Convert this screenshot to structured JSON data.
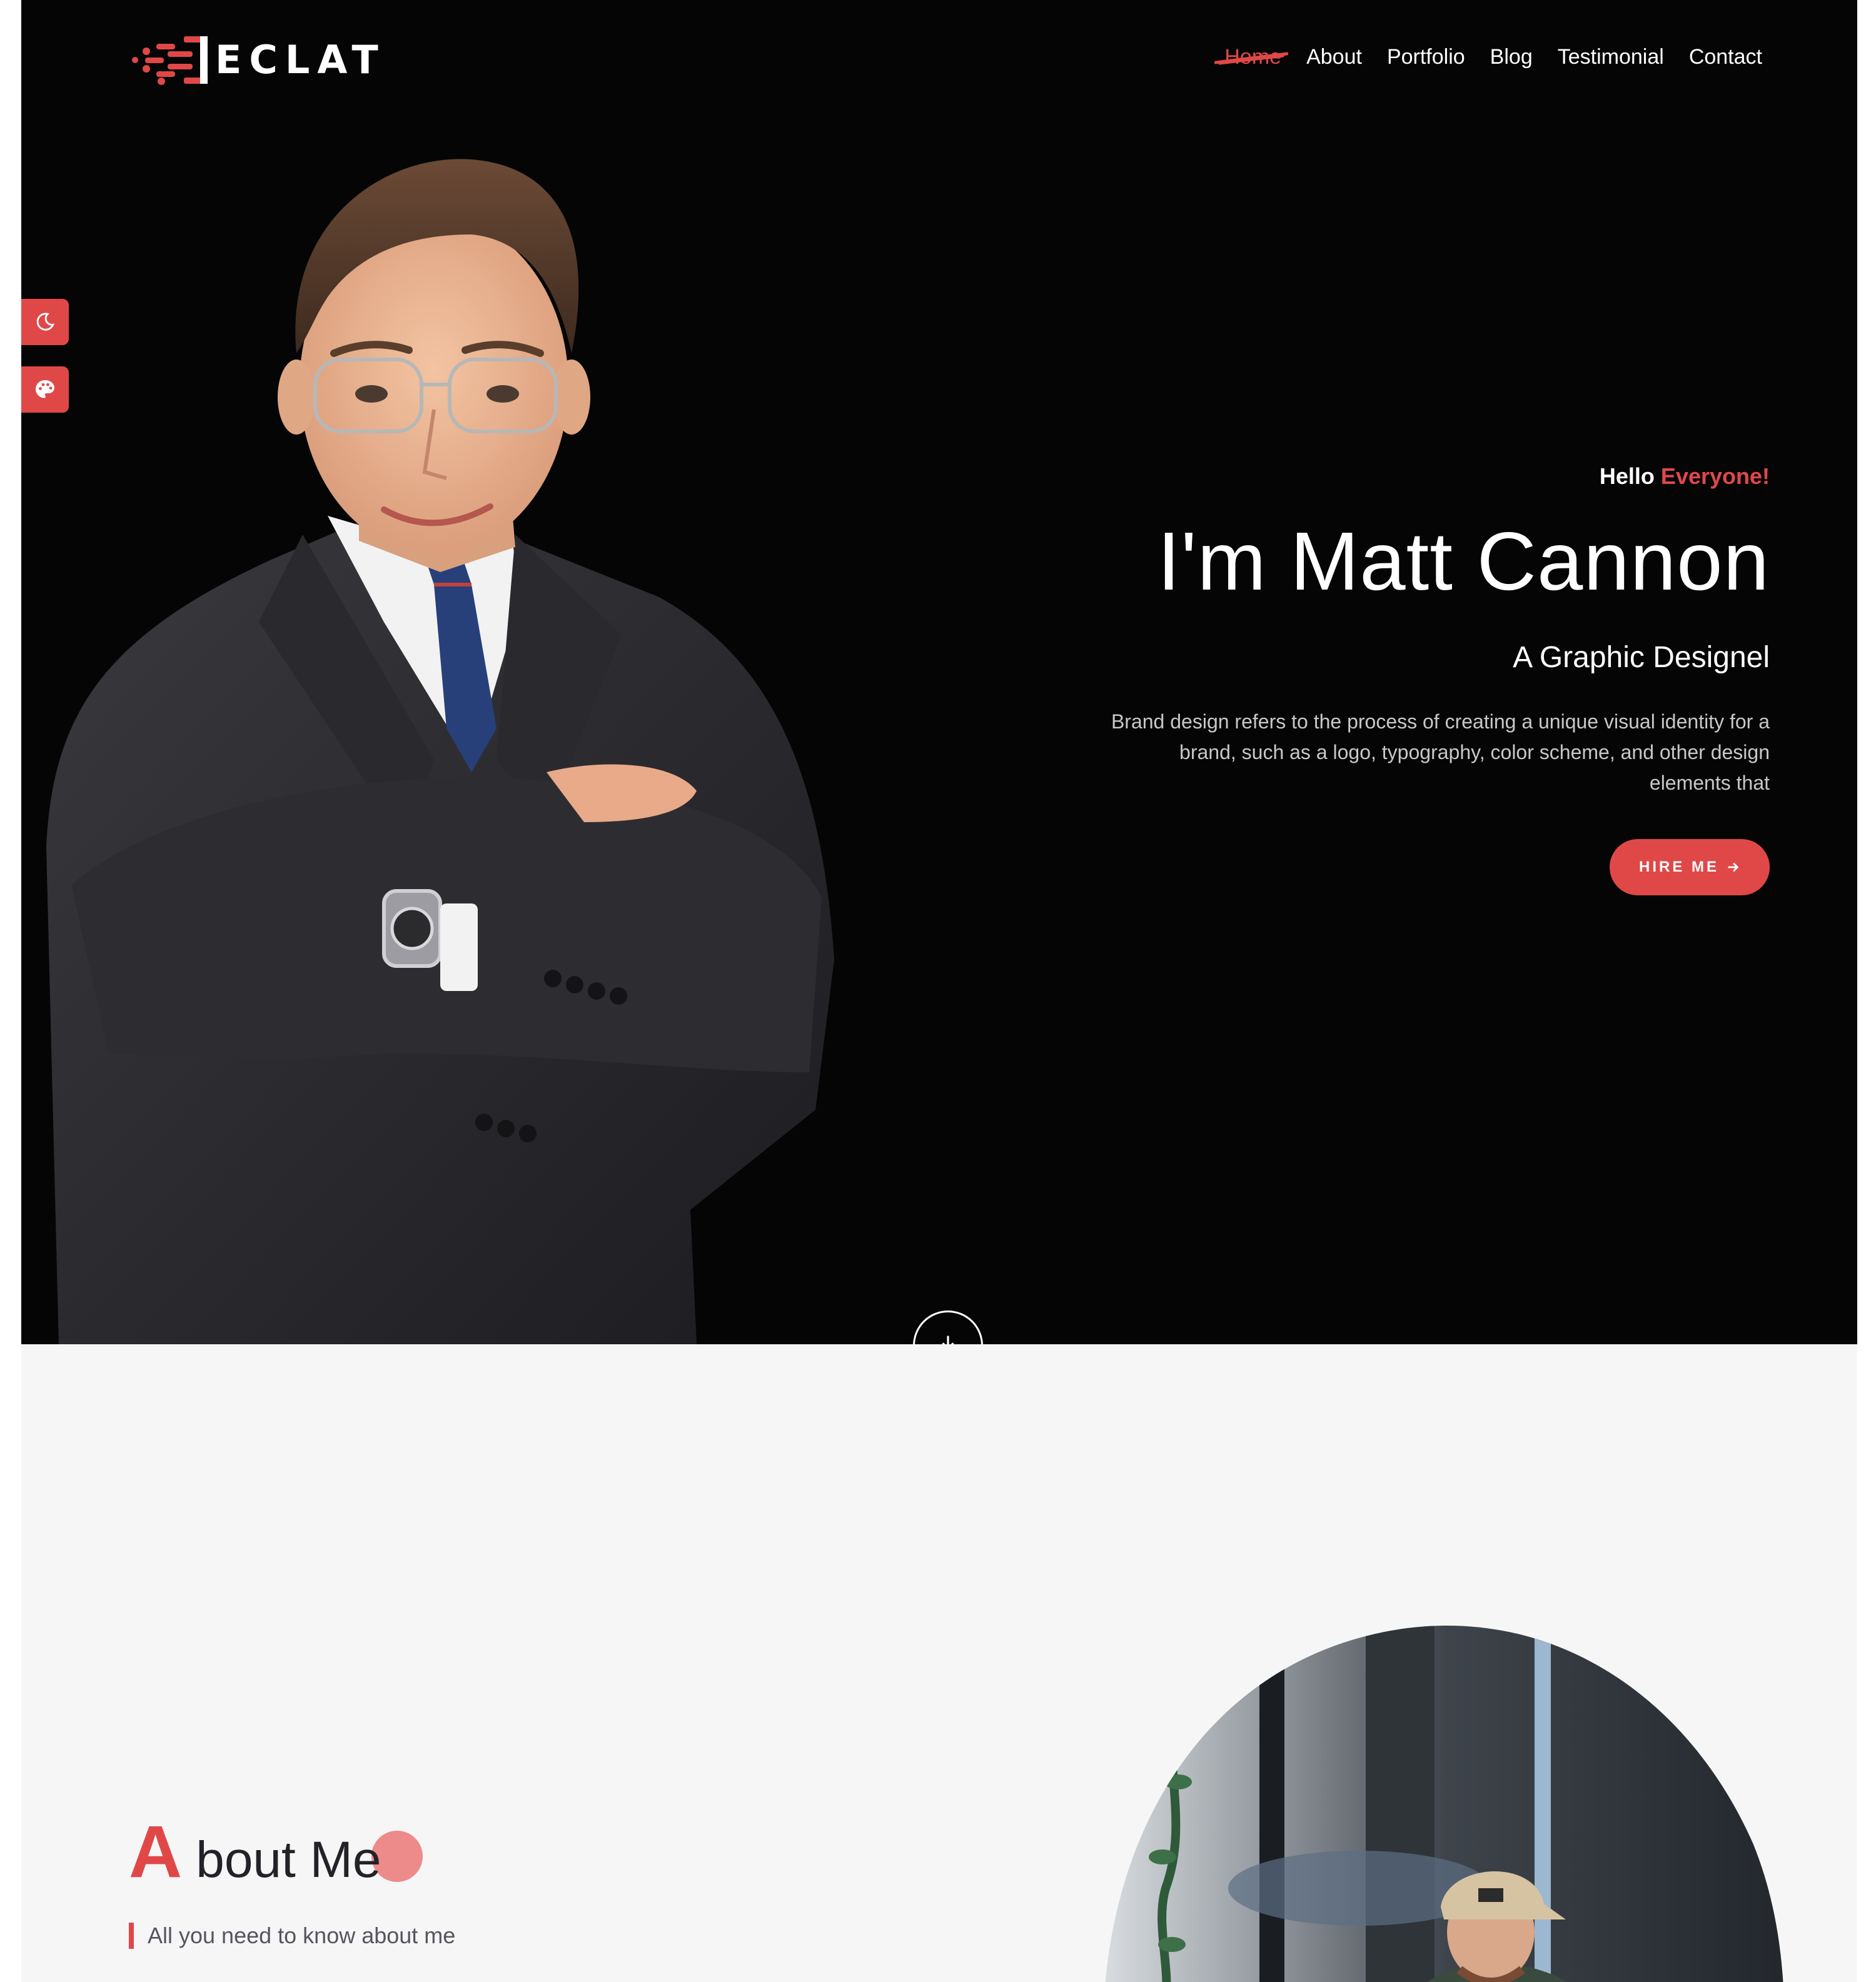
{
  "brand": {
    "name": "ECLAT",
    "accent_color": "#e04848"
  },
  "nav": {
    "items": [
      {
        "label": "Home",
        "active": true
      },
      {
        "label": "About"
      },
      {
        "label": "Portfolio"
      },
      {
        "label": "Blog"
      },
      {
        "label": "Testimonial"
      },
      {
        "label": "Contact"
      }
    ]
  },
  "side_tools": {
    "dark_mode_icon": "moon-icon",
    "theme_color_icon": "palette-icon"
  },
  "hero": {
    "greeting": "Hello",
    "greeting_accent": "Everyone!",
    "name": "I'm Matt Cannon",
    "role": "A Graphic Designel",
    "description": "Brand design refers to the process of creating a unique visual identity for a brand, such as a logo, typography, color scheme, and other design elements that",
    "cta_label": "HIRE ME",
    "cta_icon": "arrow-right-icon",
    "scroll_icon": "arrow-down-icon"
  },
  "about": {
    "title_initial": "A",
    "title_rest": "bout Me",
    "subtitle": "All you need to know about me"
  }
}
